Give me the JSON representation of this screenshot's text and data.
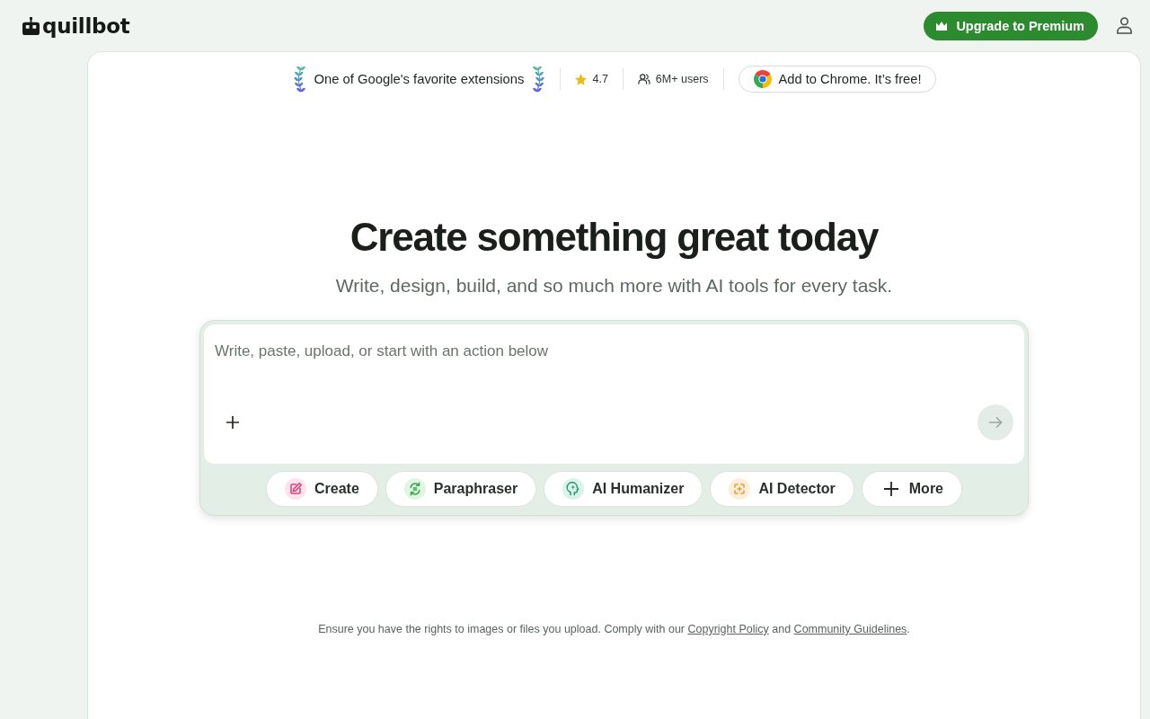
{
  "header": {
    "logo": "quillbot",
    "upgrade_button": "Upgrade to Premium"
  },
  "promo_bar": {
    "award": "One of Google's favorite extensions",
    "rating": "4.7",
    "users": "6M+ users",
    "install_button": "Add to Chrome. It’s free!"
  },
  "hero": {
    "title": "Create something great today",
    "subtitle": "Write, design, build, and so much more with AI tools for every task."
  },
  "composer": {
    "placeholder": "Write, paste, upload, or start with an action below",
    "send_button": {
      "disabled": true
    },
    "actions": [
      {
        "kind": "create",
        "label": "Create"
      },
      {
        "kind": "paraphrase",
        "label": "Paraphraser"
      },
      {
        "kind": "humanize",
        "label": "AI Humanizer"
      },
      {
        "kind": "detect",
        "label": "AI Detector"
      },
      {
        "kind": "more",
        "label": "More"
      }
    ]
  },
  "footer": {
    "segments": [
      {
        "kind": "text",
        "text": "Ensure you have the rights to images or files you upload. Comply with our "
      },
      {
        "kind": "link",
        "text": "Copyright Policy"
      },
      {
        "kind": "text",
        "text": " and "
      },
      {
        "kind": "link",
        "text": "Community Guidelines"
      },
      {
        "kind": "text",
        "text": "."
      }
    ]
  }
}
